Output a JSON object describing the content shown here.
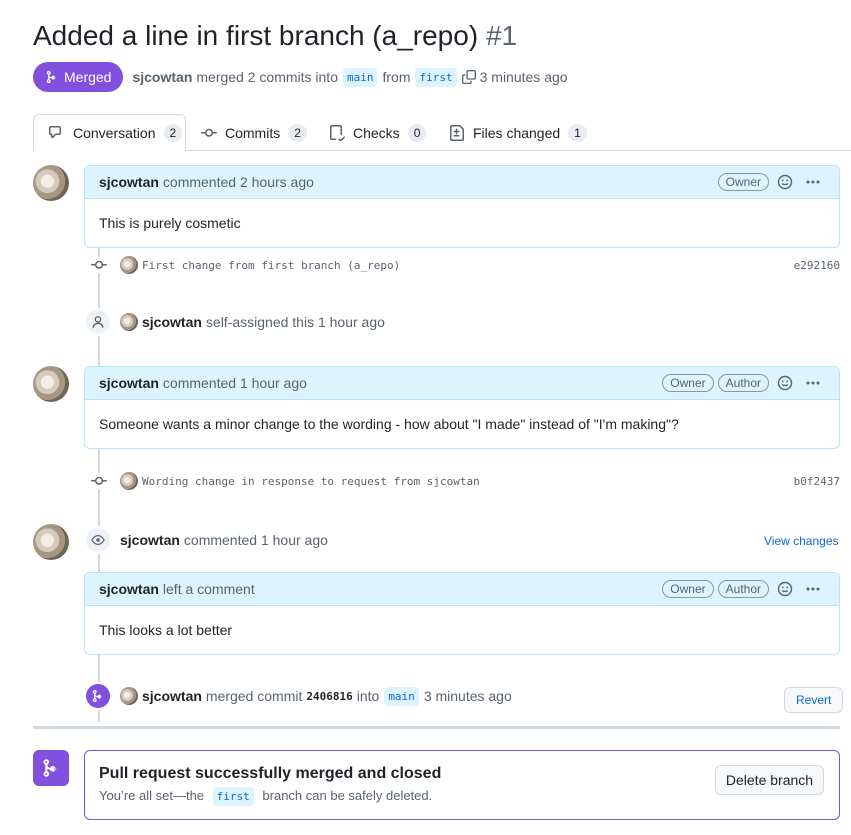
{
  "header": {
    "title": "Added a line in first branch (a_repo)",
    "number": "#1",
    "state": "Merged",
    "author": "sjcowtan",
    "merged_text": "merged 2 commits into",
    "base_branch": "main",
    "from_text": "from",
    "head_branch": "first",
    "time": "3 minutes ago"
  },
  "tabs": [
    {
      "label": "Conversation",
      "count": "2",
      "icon": "comment-discussion-icon"
    },
    {
      "label": "Commits",
      "count": "2",
      "icon": "git-commit-icon"
    },
    {
      "label": "Checks",
      "count": "0",
      "icon": "checklist-icon"
    },
    {
      "label": "Files changed",
      "count": "1",
      "icon": "file-diff-icon"
    }
  ],
  "timeline": {
    "comment1": {
      "author": "sjcowtan",
      "action": "commented 2 hours ago",
      "badges": [
        "Owner"
      ],
      "body": "This is purely cosmetic"
    },
    "commit1": {
      "message": "First change from first branch (a_repo)",
      "sha": "e292160"
    },
    "assign": {
      "author": "sjcowtan",
      "action": "self-assigned this 1 hour ago"
    },
    "comment2": {
      "author": "sjcowtan",
      "action": "commented 1 hour ago",
      "badges": [
        "Owner",
        "Author"
      ],
      "body": "Someone wants a minor change to the wording - how about \"I made\" instead of \"I'm making\"?"
    },
    "commit2": {
      "message": "Wording change in response to request from sjcowtan",
      "sha": "b0f2437"
    },
    "review": {
      "author": "sjcowtan",
      "action": "commented 1 hour ago",
      "view_changes": "View changes"
    },
    "review_comment": {
      "author": "sjcowtan",
      "action": "left a comment",
      "badges": [
        "Owner",
        "Author"
      ],
      "body": "This looks a lot better"
    },
    "merge_event": {
      "author": "sjcowtan",
      "action": "merged commit",
      "sha": "2406816",
      "into": "into",
      "branch": "main",
      "time": "3 minutes ago",
      "revert": "Revert"
    }
  },
  "merge_box": {
    "title": "Pull request successfully merged and closed",
    "sub_before": "You’re all set—the",
    "branch": "first",
    "sub_after": "branch can be safely deleted.",
    "delete_button": "Delete branch"
  },
  "colors": {
    "merged": "#8250df",
    "link": "#0969da",
    "comment_header": "#ddf4ff"
  }
}
